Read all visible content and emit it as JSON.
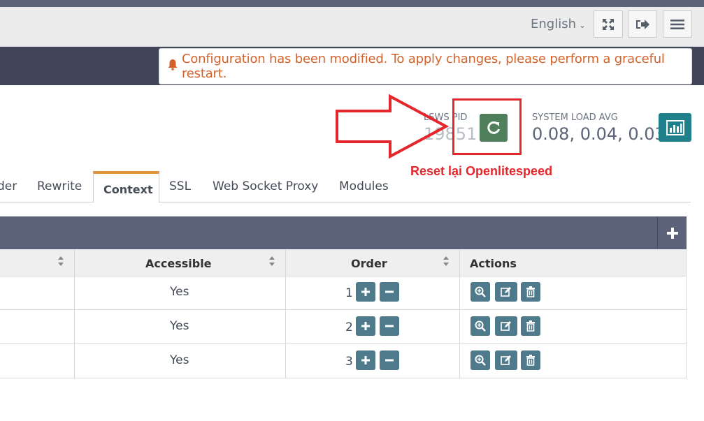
{
  "header": {
    "language": "English",
    "icons": [
      "fullscreen-icon",
      "logout-icon",
      "menu-icon"
    ]
  },
  "alert": {
    "message": "Configuration has been modified. To apply changes, please perform a graceful restart.",
    "icon": "bell-icon",
    "color": "#d2622a"
  },
  "status": {
    "pid_label": "LSWS PID",
    "pid_value": "19851",
    "load_label": "SYSTEM LOAD AVG",
    "load_value": "0.08, 0.04, 0.03"
  },
  "annotation": {
    "text": "Reset lại Openlitespeed",
    "color": "#e4262d"
  },
  "tabs": [
    {
      "label": "der"
    },
    {
      "label": "Rewrite"
    },
    {
      "label": "Context",
      "active": true
    },
    {
      "label": "SSL"
    },
    {
      "label": "Web Socket Proxy"
    },
    {
      "label": "Modules"
    }
  ],
  "table": {
    "columns": [
      "Accessible",
      "Order",
      "Actions"
    ],
    "rows": [
      {
        "accessible": "Yes",
        "order": "1"
      },
      {
        "accessible": "Yes",
        "order": "2"
      },
      {
        "accessible": "Yes",
        "order": "3"
      }
    ]
  },
  "colors": {
    "accent_tab": "#e0913a",
    "table_header": "#5b627a",
    "restart_button": "#4f7f5b",
    "stats_button": "#1f7f8a",
    "action_button": "#4e7a8c"
  }
}
